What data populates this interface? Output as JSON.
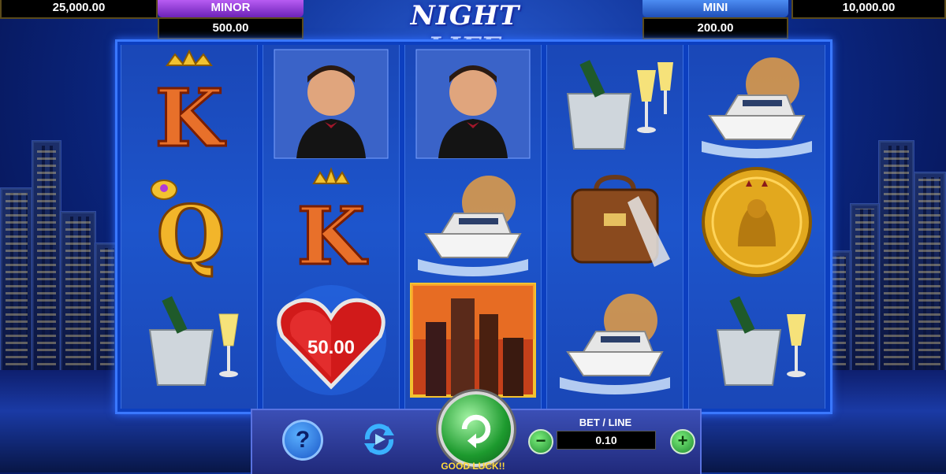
{
  "jackpots": {
    "major_value": "25,000.00",
    "minor_label": "MINOR",
    "minor_value": "500.00",
    "mini_label": "MINI",
    "mini_value": "200.00",
    "grand_value": "10,000.00"
  },
  "logo_text": "NIGHT LIFE",
  "reels": [
    [
      "king-card-icon",
      "queen-card-icon",
      "champagne-bucket-icon"
    ],
    [
      "gentleman-portrait-icon",
      "king-card-icon",
      "ruby-heart-icon"
    ],
    [
      "gentleman-portrait-icon",
      "yacht-icon",
      "city-skyline-icon"
    ],
    [
      "champagne-bucket-icon",
      "travel-bag-icon",
      "yacht-icon"
    ],
    [
      "yacht-icon",
      "gold-lion-coin-icon",
      "champagne-bucket-icon"
    ]
  ],
  "card_letters": {
    "king": "K",
    "queen": "Q"
  },
  "heart_amount": "50.00",
  "controls": {
    "help_label": "?",
    "bet_label": "BET / LINE",
    "bet_value": "0.10",
    "minus_label": "−",
    "plus_label": "+",
    "message": "GOOD LUCK!!"
  },
  "colors": {
    "minor_tab": "#8a3ad6",
    "mini_tab": "#2f6ad6",
    "reel_bg": "#1d55cc",
    "frame": "#3a78ff",
    "spin_button": "#1d9a2e",
    "message": "#ffd93a"
  }
}
